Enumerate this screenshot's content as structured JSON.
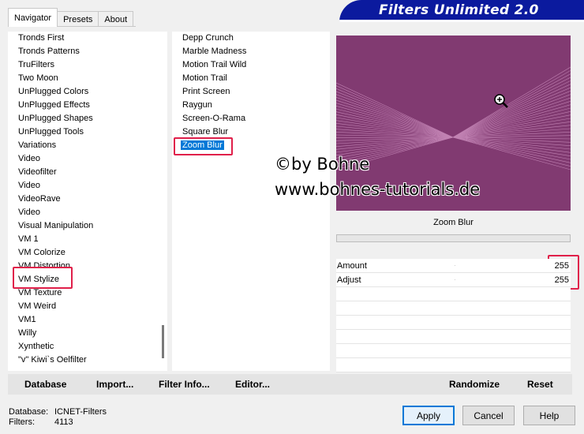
{
  "tabs": [
    {
      "label": "Navigator",
      "active": true
    },
    {
      "label": "Presets",
      "active": false
    },
    {
      "label": "About",
      "active": false
    }
  ],
  "banner": {
    "title": "Filters Unlimited 2.0",
    "color": "#0b1a9e"
  },
  "categories": [
    "Tronds First",
    "Tronds Patterns",
    "TruFilters",
    "Two Moon",
    "UnPlugged Colors",
    "UnPlugged Effects",
    "UnPlugged Shapes",
    "UnPlugged Tools",
    "Variations",
    "Video",
    "Videofilter",
    "Video",
    "VideoRave",
    "Video",
    "Visual Manipulation",
    "VM 1",
    "VM Colorize",
    "VM Distortion",
    "VM Stylize",
    "VM Texture",
    "VM Weird",
    "VM1",
    "Willy",
    "Xynthetic",
    "\"v\" Kiwi`s Oelfilter"
  ],
  "selected_category": "VM Stylize",
  "filters": [
    "Depp Crunch",
    "Marble Madness",
    "Motion Trail Wild",
    "Motion Trail",
    "Print Screen",
    "Raygun",
    "Screen-O-Rama",
    "Square Blur",
    "Zoom Blur"
  ],
  "selected_filter": "Zoom Blur",
  "preview": {
    "background": "#813a71",
    "zoom_icon": "magnifier-zoom-icon"
  },
  "watermark": {
    "line1": "©by Bohne",
    "line2": "www.bohnes-tutorials.de"
  },
  "filter_name": "Zoom Blur",
  "params": [
    {
      "label": "Amount",
      "value": "255"
    },
    {
      "label": "Adjust",
      "value": "255"
    }
  ],
  "bottom_bar": {
    "database": "Database",
    "import": "Import...",
    "filter_info": "Filter Info...",
    "editor": "Editor...",
    "randomize": "Randomize",
    "reset": "Reset"
  },
  "status": {
    "database_label": "Database:",
    "database_value": "ICNET-Filters",
    "filters_label": "Filters:",
    "filters_value": "4113"
  },
  "buttons": {
    "apply": "Apply",
    "cancel": "Cancel",
    "help": "Help"
  },
  "highlight_color": "#e0204a"
}
